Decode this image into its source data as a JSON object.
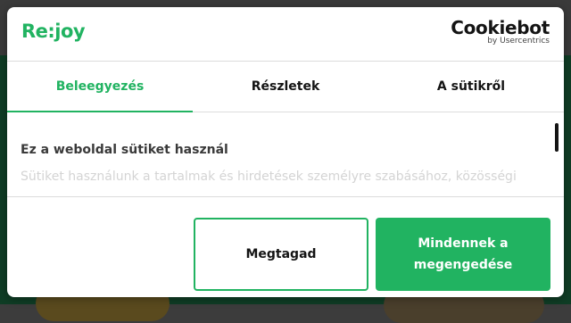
{
  "brand": {
    "logo_text": "Re:joy"
  },
  "cookiebot": {
    "name": "Cookiebot",
    "byline": "by Usercentrics"
  },
  "tabs": [
    {
      "label": "Beleegyezés",
      "active": true
    },
    {
      "label": "Részletek",
      "active": false
    },
    {
      "label": "A sütikről",
      "active": false
    }
  ],
  "content": {
    "title": "Ez a weboldal sütiket használ",
    "body": "Sütiket használunk a tartalmak és hirdetések személyre szabásához, közösségi"
  },
  "buttons": {
    "deny_label": "Megtagad",
    "allow_all_label": "Mindennek a megengedése"
  },
  "colors": {
    "accent": "#21b361",
    "text": "#141414",
    "muted_text": "#d4d4d4"
  }
}
